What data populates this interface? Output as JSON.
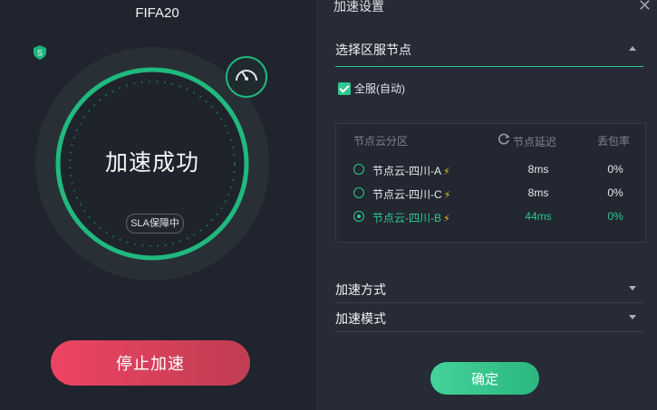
{
  "game": {
    "title": "FIFA20"
  },
  "status": {
    "text": "加速成功",
    "sla_badge": "SLA保障中",
    "shield_letter": "S"
  },
  "actions": {
    "stop_label": "停止加速",
    "confirm_label": "确定"
  },
  "panel": {
    "title": "加速设置",
    "close_icon": "close-icon",
    "region_section": {
      "title": "选择区服节点",
      "auto_checkbox": {
        "label": "全服(自动)",
        "checked": true
      },
      "columns": {
        "zone": "节点云分区",
        "latency": "节点延迟",
        "loss": "丢包率"
      },
      "nodes": [
        {
          "name": "节点云-四川-A",
          "latency": "8ms",
          "loss": "0%",
          "selected": false
        },
        {
          "name": "节点云-四川-C",
          "latency": "8ms",
          "loss": "0%",
          "selected": false
        },
        {
          "name": "节点云-四川-B",
          "latency": "44ms",
          "loss": "0%",
          "selected": true
        }
      ]
    },
    "method_section": {
      "title": "加速方式"
    },
    "mode_section": {
      "title": "加速模式"
    }
  },
  "colors": {
    "accent": "#2ec98f",
    "stop": "#ee4463",
    "bolt": "#f5c518"
  }
}
